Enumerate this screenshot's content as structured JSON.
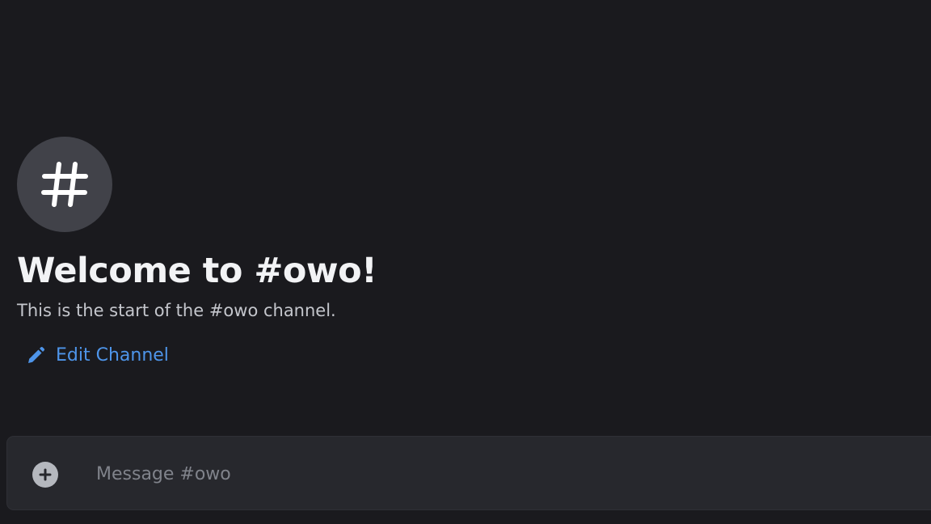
{
  "channel": {
    "name": "owo",
    "avatar_icon": "hashtag-icon",
    "welcome_title": "Welcome to #owo!",
    "welcome_subtitle": "This is the start of the #owo channel.",
    "edit_label": "Edit Channel",
    "edit_icon": "pencil-icon"
  },
  "composer": {
    "placeholder": "Message #owo",
    "value": "",
    "add_icon": "plus-circle-icon"
  },
  "colors": {
    "background": "#1a1a1e",
    "avatar_bg": "#414249",
    "title": "#f2f3f5",
    "subtitle": "#c4c6cc",
    "link": "#4e95ea",
    "composer_bg": "#27282d",
    "placeholder": "#80838b"
  }
}
